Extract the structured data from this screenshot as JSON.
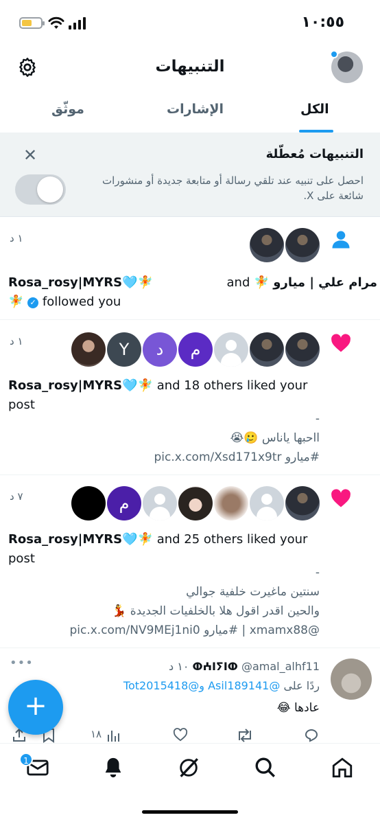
{
  "status_bar": {
    "time": "١٠:٥٥"
  },
  "header": {
    "title": "التنبيهات"
  },
  "tabs": [
    {
      "label": "الكل",
      "active": true
    },
    {
      "label": "الإشارات",
      "active": false
    },
    {
      "label": "موثّق",
      "active": false
    }
  ],
  "banner": {
    "title": "التنبيهات مُعطّلة",
    "description": "احصل على تنبيه عند تلقي رسالة أو متابعة جديدة أو منشورات شائعة على X.",
    "close_icon": "close-icon",
    "toggle_on": false
  },
  "notifications": [
    {
      "type": "follow",
      "time": "١ د",
      "name_1": "مرام علي | ميارو",
      "name_1_suffix": "🧚",
      "and": "and",
      "name_2": "Rosa_rosy|MYRS",
      "name_2_suffix": "🩵🧚",
      "action": "followed you"
    },
    {
      "type": "like",
      "time": "١ د",
      "actor": "Rosa_rosy|MYRS",
      "actor_suffix": "🩵🧚",
      "action": "and 18 others liked your post",
      "avatar_letters": [
        "Y",
        "د",
        "م"
      ],
      "preview": [
        "-",
        "ااحبها ياناس 🥲😭",
        "#ميارو pic.x.com/Xsd171x9tr"
      ]
    },
    {
      "type": "like",
      "time": "٧ د",
      "actor": "Rosa_rosy|MYRS",
      "actor_suffix": "🩵🧚",
      "action": "and 25 others liked your post",
      "avatar_letters": [
        "م"
      ],
      "preview": [
        "-",
        "سنتين ماغيرت خلفية جوالي",
        "والحين اقدر اقول هلا بالخلفيات الجديدة 💃",
        "@xmamx88 | #ميارو pic.x.com/NV9MEj1ni0"
      ]
    }
  ],
  "tweet": {
    "author": "ⵀⵄⵏⵢⵏⵀ",
    "handle": "@amal_alhf11",
    "time": "١٠ د",
    "reply_to_label": "ردًا على",
    "reply_to": "@Asil189141 و@Tot2015418",
    "text": "عادها 😂",
    "views": "١٨"
  },
  "fab": {
    "label": "+"
  },
  "tabbar": {
    "messages_badge": "1"
  }
}
